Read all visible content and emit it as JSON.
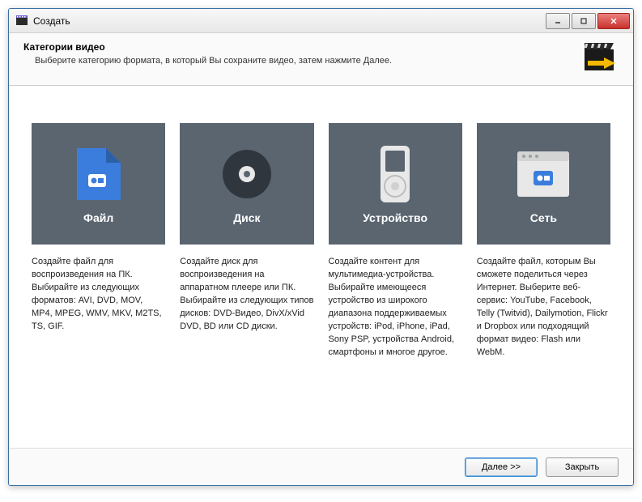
{
  "titlebar": {
    "title": "Создать"
  },
  "header": {
    "title": "Категории видео",
    "subtitle": "Выберите категорию формата, в который Вы сохраните видео, затем нажмите Далее."
  },
  "categories": [
    {
      "label": "Файл",
      "description": "Создайте файл для воспроизведения на ПК. Выбирайте из следующих форматов: AVI, DVD, MOV, MP4, MPEG, WMV, MKV, M2TS, TS, GIF."
    },
    {
      "label": "Диск",
      "description": "Создайте диск для воспроизведения на аппаратном плеере или ПК. Выбирайте из следующих типов дисков: DVD-Видео, DivX/xVid DVD, BD или CD диски."
    },
    {
      "label": "Устройство",
      "description": "Создайте контент для мультимедиа-устройства. Выбирайте имеющееся устройство из широкого диапазона поддерживаемых устройств: iPod, iPhone, iPad, Sony PSP, устройства Android, смартфоны и многое другое."
    },
    {
      "label": "Сеть",
      "description": "Создайте файл, которым Вы сможете поделиться через Интернет. Выберите веб-сервис: YouTube, Facebook, Telly (Twitvid), Dailymotion, Flickr и Dropbox или подходящий формат видео: Flash или WebM."
    }
  ],
  "footer": {
    "next": "Далее >>",
    "close": "Закрыть"
  }
}
